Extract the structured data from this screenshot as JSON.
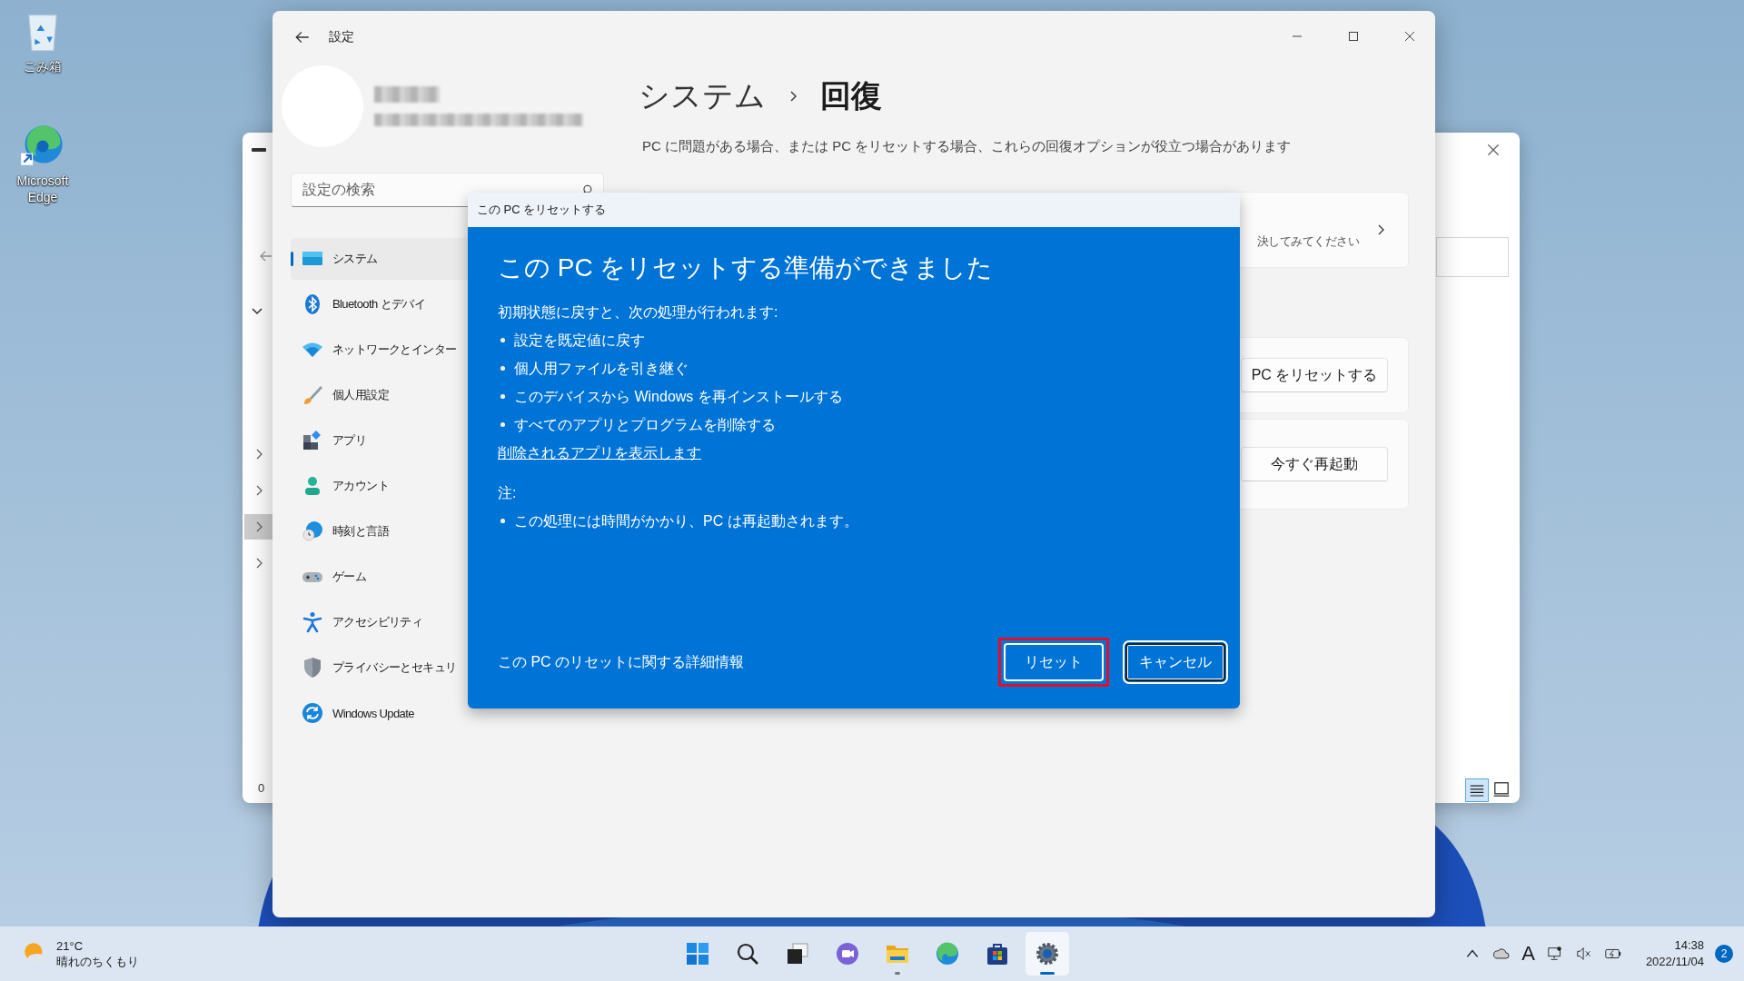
{
  "desktop_icons": [
    {
      "kind": "recycle",
      "label": "ごみ箱"
    },
    {
      "kind": "edge",
      "label": "Microsoft Edge"
    }
  ],
  "background_window": {
    "status_text": "0"
  },
  "settings": {
    "title": "設定",
    "search": {
      "placeholder": "設定の検索"
    },
    "nav": [
      {
        "kind": "system",
        "label": "システム",
        "selected": true
      },
      {
        "kind": "bluetooth",
        "label": "Bluetooth とデバイ",
        "selected": false
      },
      {
        "kind": "network",
        "label": "ネットワークとインター",
        "selected": false
      },
      {
        "kind": "personalize",
        "label": "個人用設定",
        "selected": false
      },
      {
        "kind": "apps",
        "label": "アプリ",
        "selected": false
      },
      {
        "kind": "account",
        "label": "アカウント",
        "selected": false
      },
      {
        "kind": "time",
        "label": "時刻と言語",
        "selected": false
      },
      {
        "kind": "game",
        "label": "ゲーム",
        "selected": false
      },
      {
        "kind": "accessibility",
        "label": "アクセシビリティ",
        "selected": false
      },
      {
        "kind": "privacy",
        "label": "プライバシーとセキュリ",
        "selected": false
      },
      {
        "kind": "update",
        "label": "Windows Update",
        "selected": false
      }
    ],
    "breadcrumb": [
      "システム",
      "回復"
    ],
    "description": "PC に問題がある場合、または PC をリセットする場合、これらの回復オプションが役立つ場合があります",
    "cards": [
      {
        "kind": "link",
        "text": "決してみてください"
      },
      {
        "kind": "button",
        "button": "PC をリセットする"
      },
      {
        "kind": "button",
        "button": "今すぐ再起動"
      }
    ]
  },
  "dialog": {
    "title": "この PC をリセットする",
    "heading": "この PC をリセットする準備ができました",
    "intro": "初期状態に戻すと、次の処理が行われます:",
    "items": [
      "設定を既定値に戻す",
      "個人用ファイルを引き継ぐ",
      "このデバイスから Windows を再インストールする",
      "すべてのアプリとプログラムを削除する"
    ],
    "link": "削除されるアプリを表示します",
    "note_label": "注:",
    "notes": [
      "この処理には時間がかかり、PC は再起動されます。"
    ],
    "more_info": "この PC のリセットに関する詳細情報",
    "buttons": [
      {
        "label": "リセット",
        "annotated": true,
        "focused": false
      },
      {
        "label": "キャンセル",
        "annotated": false,
        "focused": true
      }
    ]
  },
  "taskbar": {
    "weather": {
      "temp": "21°C",
      "condition": "晴れのちくもり"
    },
    "apps": [
      {
        "kind": "start",
        "running": false,
        "active": false
      },
      {
        "kind": "search",
        "running": false,
        "active": false
      },
      {
        "kind": "taskview",
        "running": false,
        "active": false
      },
      {
        "kind": "chat",
        "running": false,
        "active": false
      },
      {
        "kind": "explorer",
        "running": true,
        "active": false
      },
      {
        "kind": "edge",
        "running": false,
        "active": false
      },
      {
        "kind": "store",
        "running": false,
        "active": false
      },
      {
        "kind": "settings",
        "running": true,
        "active": true
      }
    ],
    "ime": "A",
    "time": "14:38",
    "date": "2022/11/04",
    "notification_count": "2"
  }
}
